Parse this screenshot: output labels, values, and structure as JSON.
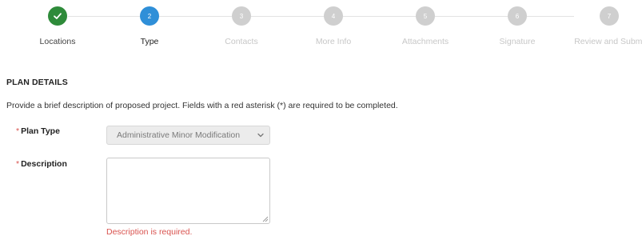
{
  "stepper": {
    "steps": [
      {
        "number": "",
        "label": "Locations",
        "state": "done",
        "icon": "checkmark-icon"
      },
      {
        "number": "2",
        "label": "Type",
        "state": "active"
      },
      {
        "number": "3",
        "label": "Contacts",
        "state": "todo"
      },
      {
        "number": "4",
        "label": "More Info",
        "state": "todo"
      },
      {
        "number": "5",
        "label": "Attachments",
        "state": "todo"
      },
      {
        "number": "6",
        "label": "Signature",
        "state": "todo"
      },
      {
        "number": "7",
        "label": "Review and Submi",
        "state": "todo"
      }
    ],
    "colors": {
      "done": "#2e8b3a",
      "active": "#2f8fd8",
      "todo": "#cfcfcf"
    }
  },
  "form": {
    "section_title": "PLAN DETAILS",
    "intro": "Provide a brief description of proposed project. Fields with a red asterisk (*) are required to be completed.",
    "plan_type": {
      "label": "Plan Type",
      "required_marker": "*",
      "selected": "Administrative Minor Modification",
      "icon": "chevron-down-icon"
    },
    "description": {
      "label": "Description",
      "required_marker": "*",
      "value": "",
      "error": "Description is required."
    },
    "error_color": "#d9534f"
  }
}
